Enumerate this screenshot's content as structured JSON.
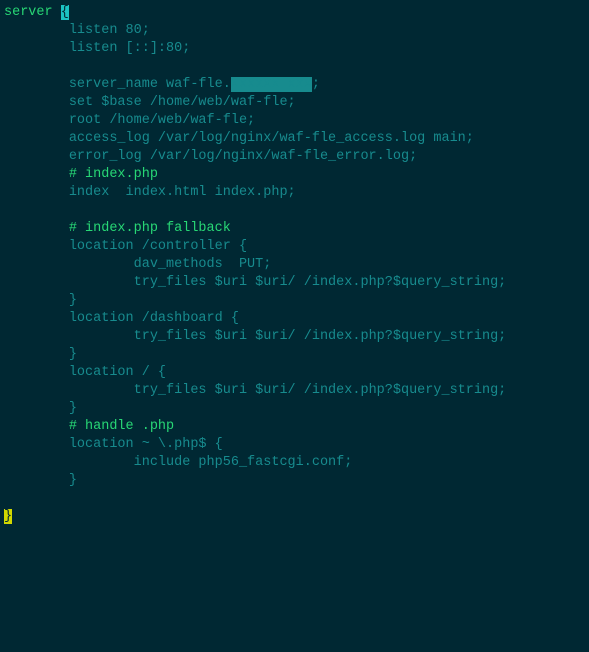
{
  "config": {
    "kw_server": "server",
    "sp1": " ",
    "bracket_open": "{",
    "indent": "        ",
    "indent2": "                ",
    "listen1": "listen 80;",
    "listen2": "listen [::]:80;",
    "server_name_prefix": "server_name waf-fle.",
    "redacted": "xxxxxx xxx",
    "server_name_suffix": ";",
    "set_base": "set $base /home/web/waf-fle;",
    "root": "root /home/web/waf-fle;",
    "access_log": "access_log /var/log/nginx/waf-fle_access.log main;",
    "error_log": "error_log /var/log/nginx/waf-fle_error.log;",
    "c_indexphp": "# index.php",
    "index_dir": "index  index.html index.php;",
    "c_fallback": "# index.php fallback",
    "loc_controller_open": "location /controller {",
    "dav_methods": "dav_methods  PUT;",
    "try_files": "try_files $uri $uri/ /index.php?$query_string;",
    "brace_close": "}",
    "loc_dashboard_open": "location /dashboard {",
    "loc_root_open": "location / {",
    "c_handle": "# handle .php",
    "loc_php_open": "location ~ \\.php$ {",
    "include_fcgi": "include php56_fastcgi.conf;",
    "final_brace": "}"
  }
}
